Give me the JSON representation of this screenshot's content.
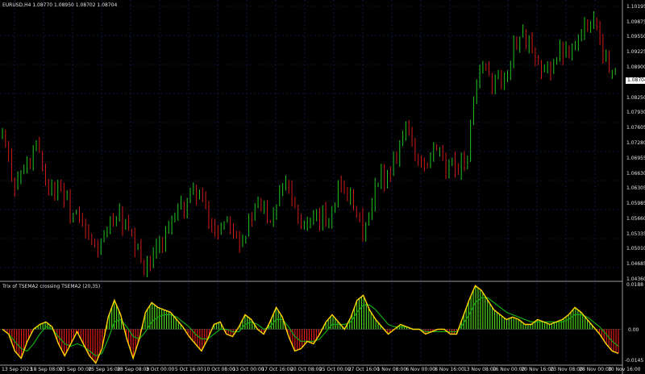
{
  "header": {
    "symbol_line": "EURUSD,H4  1.08770 1.08950 1.08702 1.08704"
  },
  "indicator": {
    "title": "Trix of TSEMA2 crossing TSEMA2 (20,35)",
    "levels": [
      "0.0188",
      "0.00",
      "-0.0145"
    ]
  },
  "price_axis": {
    "labels": [
      "1.10195",
      "1.09875",
      "1.09550",
      "1.09225",
      "1.08900",
      "1.08575",
      "1.08250",
      "1.07930",
      "1.07605",
      "1.07280",
      "1.06955",
      "1.06630",
      "1.06305",
      "1.05985",
      "1.05660",
      "1.05335",
      "1.05010",
      "1.04685",
      "1.04360"
    ],
    "current_price": "1.08704"
  },
  "time_axis": {
    "labels": [
      "13 Sep 2023",
      "18 Sep 08:00",
      "21 Sep 00:00",
      "25 Sep 16:00",
      "28 Sep 08:00",
      "3 Oct 00:00",
      "5 Oct 16:00",
      "10 Oct 08:00",
      "13 Oct 00:00",
      "17 Oct 16:00",
      "20 Oct 08:00",
      "25 Oct 00:00",
      "27 Oct 16:00",
      "1 Nov 08:00",
      "6 Nov 00:00",
      "8 Nov 16:00",
      "13 Nov 08:00",
      "16 Nov 00:00",
      "20 Nov 16:00",
      "23 Nov 08:00",
      "28 Nov 00:00",
      "30 Nov 16:00"
    ]
  },
  "colors": {
    "background": "#000000",
    "bull": "#22c322",
    "bear": "#d11a1a",
    "grid": "#1b2a6e",
    "hist_up": "#4fd21e",
    "hist_down": "#e21a1a",
    "trix_line": "#ffd400",
    "signal_line": "#13a813",
    "separator": "#9a9a9a",
    "axis_text": "#e0e0e0"
  },
  "chart_data": {
    "type": "candlestick",
    "symbol": "EURUSD",
    "timeframe": "H4",
    "ylim": [
      1.0436,
      1.10195
    ],
    "path_prices": [
      1.074,
      1.069,
      1.064,
      1.066,
      1.068,
      1.07,
      1.072,
      1.065,
      1.063,
      1.064,
      1.062,
      1.058,
      1.057,
      1.055,
      1.052,
      1.05,
      1.051,
      1.053,
      1.057,
      1.057,
      1.055,
      1.052,
      1.049,
      1.047,
      1.046,
      1.049,
      1.052,
      1.055,
      1.056,
      1.058,
      1.06,
      1.062,
      1.063,
      1.058,
      1.055,
      1.054,
      1.056,
      1.057,
      1.054,
      1.052,
      1.055,
      1.058,
      1.059,
      1.058,
      1.057,
      1.062,
      1.066,
      1.063,
      1.058,
      1.056,
      1.055,
      1.055,
      1.057,
      1.056,
      1.06,
      1.064,
      1.063,
      1.059,
      1.056,
      1.054,
      1.057,
      1.063,
      1.066,
      1.066,
      1.07,
      1.073,
      1.077,
      1.072,
      1.068,
      1.067,
      1.07,
      1.072,
      1.067,
      1.067,
      1.068,
      1.069,
      1.07,
      1.084,
      1.087,
      1.088,
      1.085,
      1.087,
      1.086,
      1.091,
      1.095,
      1.096,
      1.094,
      1.089,
      1.087,
      1.089,
      1.09,
      1.092,
      1.093,
      1.094,
      1.095,
      1.097,
      1.1,
      1.098,
      1.093,
      1.088,
      1.087
    ],
    "indicator_name": "Trix of TSEMA2 crossing TSEMA2 (20,35)",
    "indicator_ylim": [
      -0.0145,
      0.0188
    ],
    "trix_series": [
      0.0,
      -0.002,
      -0.009,
      -0.012,
      -0.005,
      0.0,
      0.002,
      0.003,
      0.001,
      -0.006,
      -0.011,
      -0.006,
      -0.001,
      -0.006,
      -0.011,
      -0.014,
      -0.008,
      0.005,
      0.012,
      0.006,
      -0.004,
      -0.012,
      -0.004,
      0.007,
      0.011,
      0.009,
      0.008,
      0.007,
      0.004,
      0.001,
      -0.003,
      -0.006,
      -0.009,
      -0.004,
      0.002,
      0.003,
      -0.002,
      -0.003,
      0.001,
      0.006,
      0.004,
      0.0,
      -0.002,
      0.003,
      0.009,
      0.005,
      -0.003,
      -0.009,
      -0.008,
      -0.005,
      -0.006,
      -0.002,
      0.003,
      0.006,
      0.003,
      0.0,
      0.005,
      0.012,
      0.014,
      0.008,
      0.004,
      0.001,
      -0.002,
      0.0,
      0.002,
      0.001,
      0.0,
      0.0,
      -0.002,
      -0.001,
      0.0,
      0.0,
      -0.002,
      -0.002,
      0.005,
      0.012,
      0.018,
      0.016,
      0.012,
      0.008,
      0.006,
      0.004,
      0.005,
      0.004,
      0.002,
      0.002,
      0.004,
      0.003,
      0.002,
      0.003,
      0.004,
      0.006,
      0.009,
      0.007,
      0.004,
      0.001,
      -0.002,
      -0.006,
      -0.009,
      -0.01
    ],
    "signal_series": [
      0.0,
      -0.002,
      -0.005,
      -0.008,
      -0.009,
      -0.006,
      -0.002,
      0.001,
      0.0,
      -0.003,
      -0.006,
      -0.007,
      -0.006,
      -0.007,
      -0.009,
      -0.011,
      -0.01,
      -0.004,
      0.003,
      0.004,
      0.001,
      -0.003,
      -0.004,
      -0.001,
      0.003,
      0.005,
      0.006,
      0.006,
      0.005,
      0.003,
      0.001,
      -0.002,
      -0.004,
      -0.004,
      -0.002,
      0.0,
      0.0,
      -0.001,
      -0.001,
      0.002,
      0.003,
      0.002,
      0.0,
      0.001,
      0.004,
      0.004,
      0.001,
      -0.003,
      -0.005,
      -0.005,
      -0.005,
      -0.004,
      -0.001,
      0.002,
      0.002,
      0.002,
      0.003,
      0.007,
      0.01,
      0.01,
      0.008,
      0.005,
      0.002,
      0.001,
      0.001,
      0.001,
      0.0,
      0.0,
      -0.001,
      -0.001,
      -0.001,
      -0.001,
      -0.001,
      -0.001,
      0.002,
      0.006,
      0.011,
      0.013,
      0.013,
      0.011,
      0.009,
      0.007,
      0.006,
      0.005,
      0.004,
      0.003,
      0.003,
      0.003,
      0.003,
      0.003,
      0.003,
      0.004,
      0.006,
      0.006,
      0.005,
      0.003,
      0.001,
      -0.002,
      -0.005,
      -0.007
    ]
  }
}
